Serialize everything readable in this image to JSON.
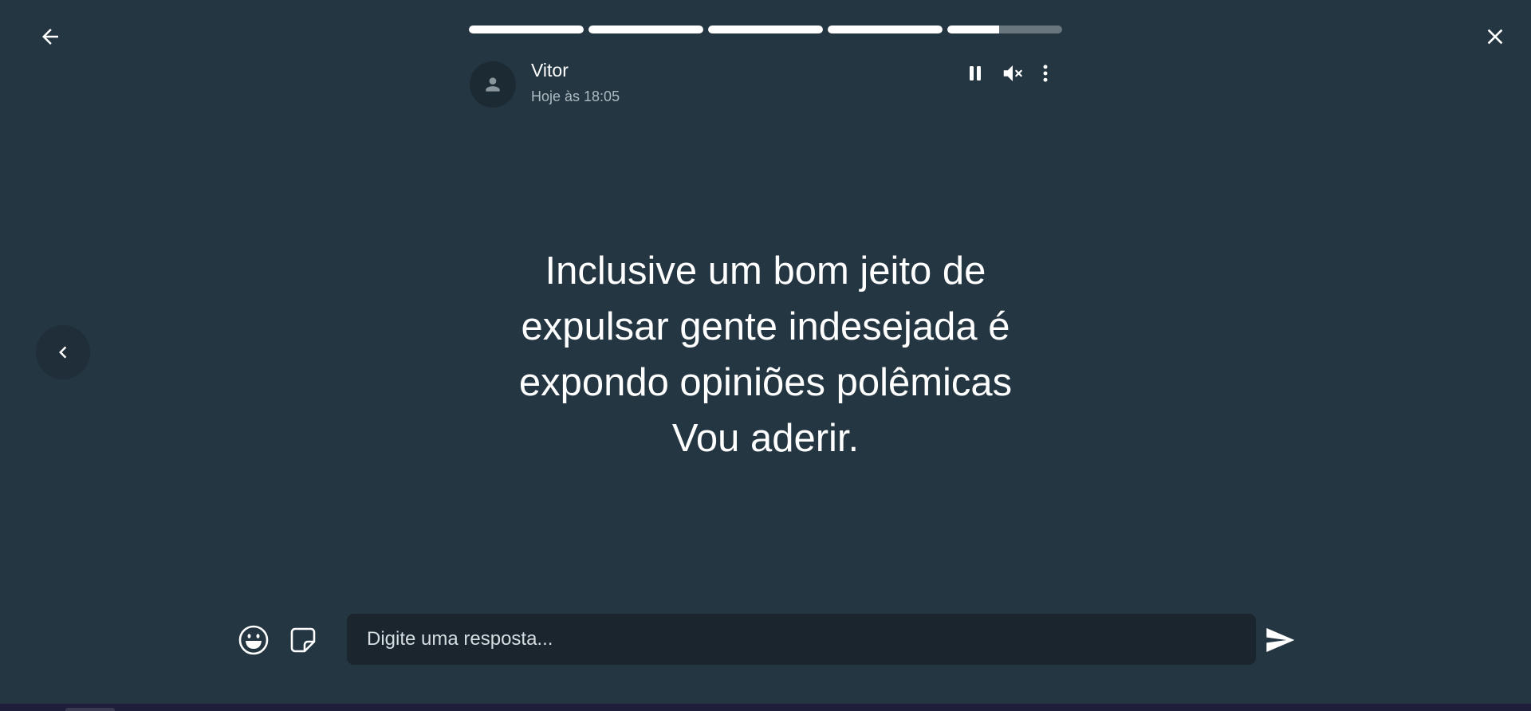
{
  "story": {
    "author": "Vitor",
    "timestamp": "Hoje às 18:05",
    "text": "Inclusive um bom jeito de\nexpulsar gente indesejada é\nexpondo opiniões polêmicas\nVou aderir.",
    "segments": [
      {
        "progress": 1.0
      },
      {
        "progress": 1.0
      },
      {
        "progress": 1.0
      },
      {
        "progress": 1.0
      },
      {
        "progress": 0.45
      }
    ]
  },
  "controls": {
    "back_icon": "arrow-left-icon",
    "close_icon": "close-icon",
    "pause_icon": "pause-icon",
    "mute_icon": "volume-muted-icon",
    "menu_icon": "more-vertical-icon",
    "prev_icon": "chevron-left-icon"
  },
  "reply": {
    "placeholder": "Digite uma resposta...",
    "value": "",
    "emoji_icon": "emoji-icon",
    "sticker_icon": "sticker-icon",
    "send_icon": "send-icon"
  },
  "colors": {
    "background": "#243642",
    "input_background": "#1a252d",
    "secondary_text": "#aebac1",
    "progress_fill": "#ffffff"
  }
}
